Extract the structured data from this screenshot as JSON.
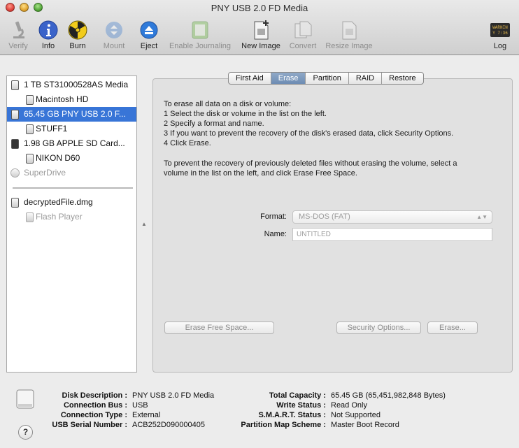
{
  "window": {
    "title": "PNY USB 2.0 FD Media"
  },
  "toolbar": {
    "verify": "Verify",
    "info": "Info",
    "burn": "Burn",
    "mount": "Mount",
    "eject": "Eject",
    "enable_journaling": "Enable Journaling",
    "new_image": "New Image",
    "convert": "Convert",
    "resize_image": "Resize Image",
    "log": "Log",
    "log_icon_text": "WARNIN\n7:36"
  },
  "sidebar": {
    "items": [
      {
        "label": "1 TB ST31000528AS Media",
        "icon": "hard-drive-icon"
      },
      {
        "label": "Macintosh HD",
        "icon": "volume-icon"
      },
      {
        "label": "65.45 GB PNY USB 2.0 F...",
        "icon": "usb-drive-icon"
      },
      {
        "label": "STUFF1",
        "icon": "volume-icon"
      },
      {
        "label": "1.98 GB APPLE SD Card...",
        "icon": "sd-card-icon"
      },
      {
        "label": "NIKON D60",
        "icon": "volume-icon"
      },
      {
        "label": "SuperDrive",
        "icon": "optical-drive-icon"
      },
      {
        "label": "decryptedFile.dmg",
        "icon": "disk-image-icon"
      },
      {
        "label": "Flash Player",
        "icon": "volume-icon"
      }
    ]
  },
  "tabs": [
    "First Aid",
    "Erase",
    "Partition",
    "RAID",
    "Restore"
  ],
  "active_tab": "Erase",
  "erase": {
    "instructions": [
      "To erase all data on a disk or volume:",
      "1 Select the disk or volume in the list on the left.",
      "2 Specify a format and name.",
      "3 If you want to prevent the recovery of the disk's erased data, click Security Options.",
      "4 Click Erase."
    ],
    "free_space_note": [
      "To prevent the recovery of previously deleted files without erasing the volume, select a",
      "volume in the list on the left, and click Erase Free Space."
    ],
    "format_label": "Format:",
    "format_value": "MS-DOS (FAT)",
    "name_label": "Name:",
    "name_value": "UNTITLED",
    "erase_free_space_button": "Erase Free Space...",
    "security_options_button": "Security Options...",
    "erase_button": "Erase..."
  },
  "info": {
    "disk_description_label": "Disk Description :",
    "disk_description": "PNY USB 2.0 FD Media",
    "connection_bus_label": "Connection Bus :",
    "connection_bus": "USB",
    "connection_type_label": "Connection Type :",
    "connection_type": "External",
    "usb_serial_label": "USB Serial Number :",
    "usb_serial": "ACB252D090000405",
    "total_capacity_label": "Total Capacity :",
    "total_capacity": "65.45 GB (65,451,982,848 Bytes)",
    "write_status_label": "Write Status :",
    "write_status": "Read Only",
    "smart_status_label": "S.M.A.R.T. Status :",
    "smart_status": "Not Supported",
    "partition_map_label": "Partition Map Scheme :",
    "partition_map": "Master Boot Record"
  },
  "help": {
    "label": "?"
  },
  "colors": {
    "selection": "#3875d7",
    "info_blue": "#3a63c9",
    "eject_blue": "#2f7ad9"
  }
}
